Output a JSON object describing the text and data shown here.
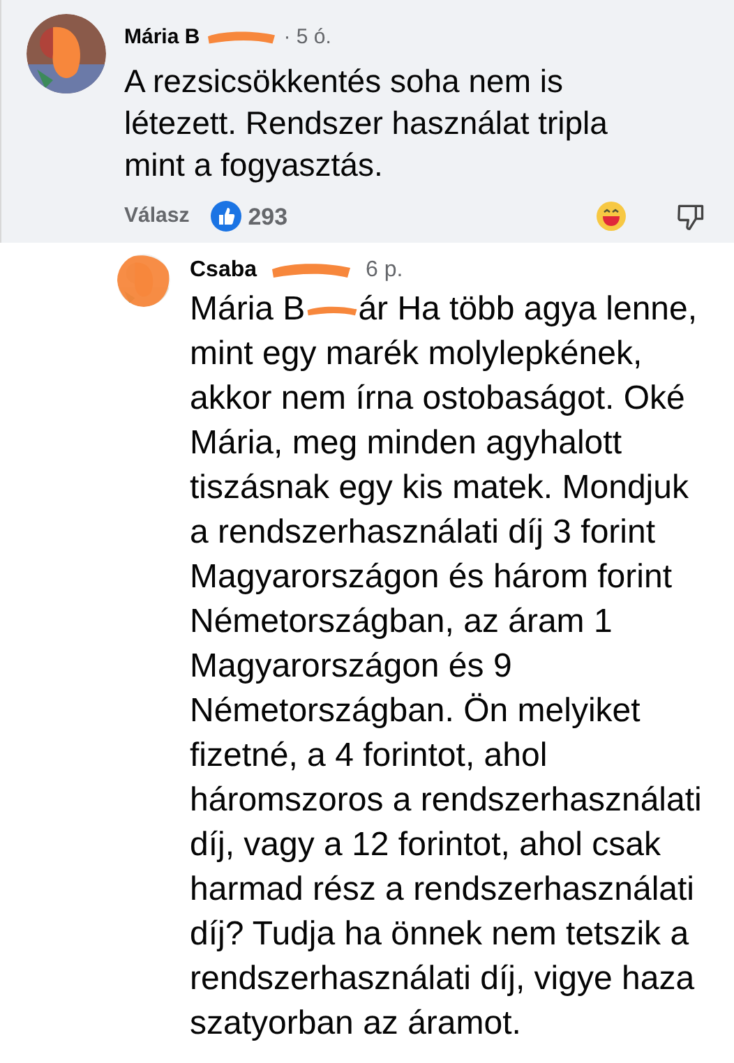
{
  "comment": {
    "author": "Mária B",
    "time": "· 5 ó.",
    "text": "A rezsicsökkentés soha nem is létezett. Rendszer használat tripla mint a fogyasztás.",
    "reply_label": "Válasz",
    "like_count": "293"
  },
  "reply": {
    "author": "Csaba",
    "time": "6 p.",
    "mention": "Mária B",
    "text": "ár Ha több agya lenne, mint egy marék molylepkének, akkor nem írna ostobaságot. Oké Mária, meg minden agyhalott tiszásnak egy kis matek. Mondjuk a rendszerhasználati díj 3 forint Magyarországon és három forint Németországban, az áram 1 Magyarországon és 9 Németországban. Ön melyiket fizetné, a 4 forintot, ahol háromszoros a rendszerhasználati díj, vagy a 12 forintot, ahol csak harmad rész a rendszerhasználati díj? Tudja ha önnek nem tetszik a rendszerhasználati díj, vigye haza szatyorban az áramot."
  }
}
